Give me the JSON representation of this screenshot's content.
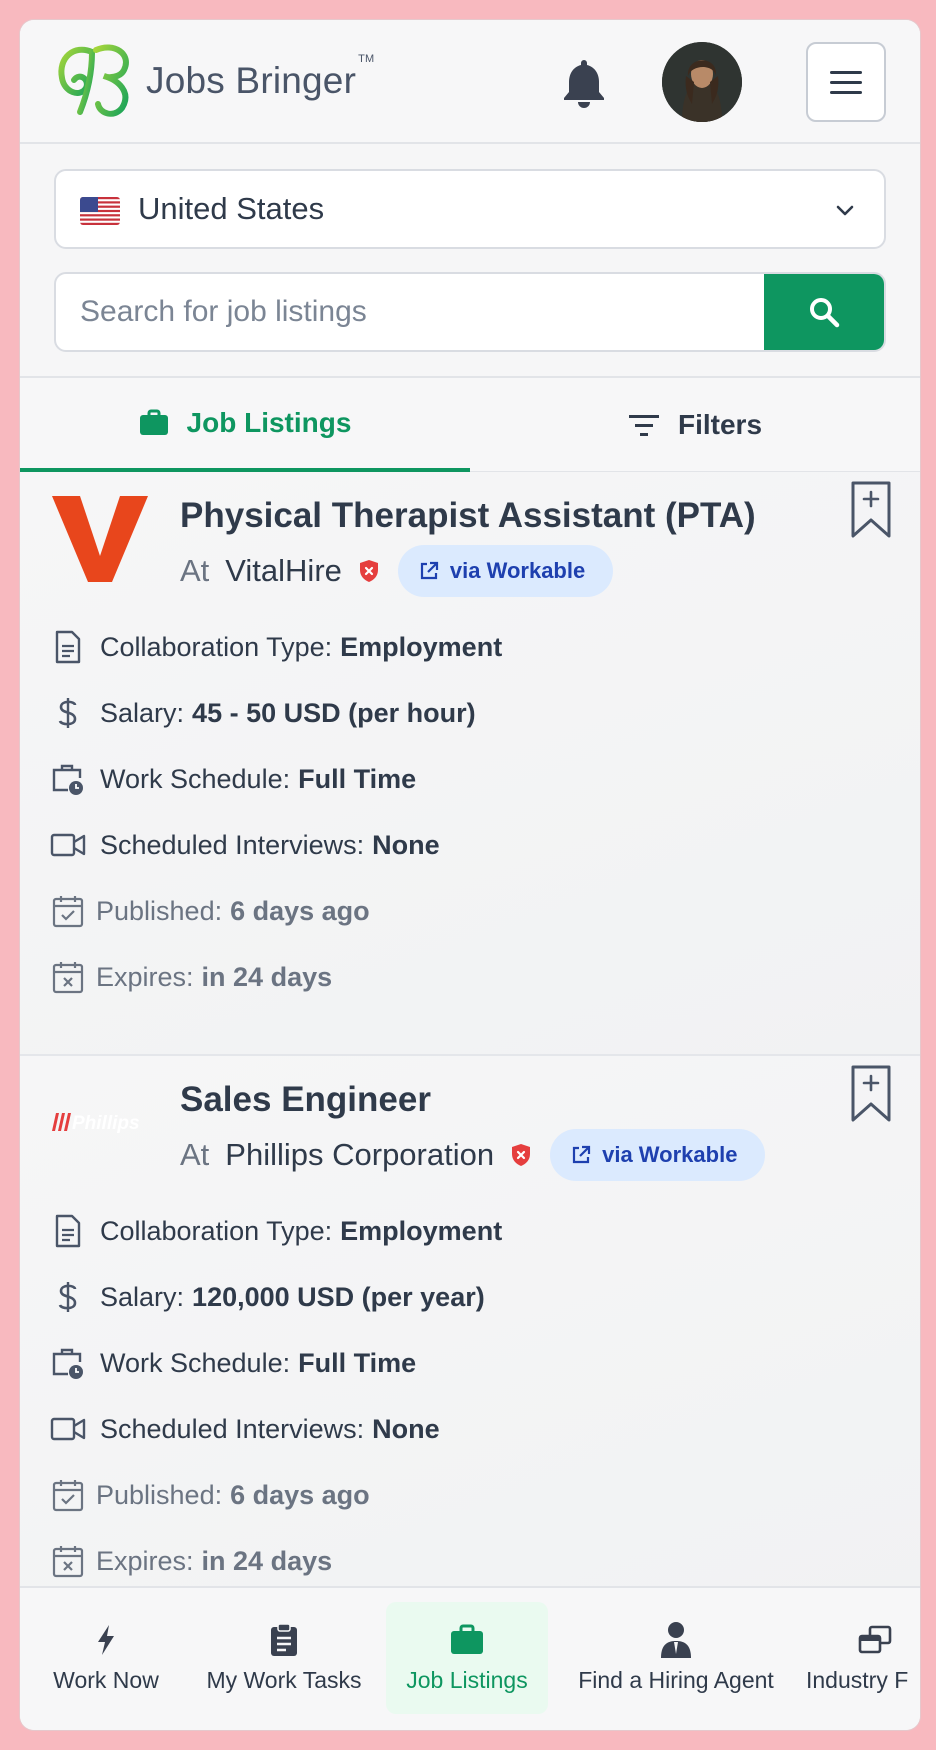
{
  "header": {
    "brand": "Jobs Bringer",
    "trademark": "TM",
    "icons": {
      "logo": "butterfly-logo",
      "notifications": "bell-icon",
      "menu": "hamburger-icon"
    }
  },
  "country": {
    "selected": "United States",
    "flag": "us-flag-icon"
  },
  "search": {
    "placeholder": "Search for job listings"
  },
  "tabs": [
    {
      "label": "Job Listings",
      "active": true
    },
    {
      "label": "Filters",
      "active": false
    }
  ],
  "jobs": [
    {
      "title": "Physical Therapist Assistant (PTA)",
      "at": "At",
      "company": "VitalHire",
      "source": "via Workable",
      "collab_label": "Collaboration Type:",
      "collab": "Employment",
      "salary_label": "Salary:",
      "salary": "45 - 50 USD (per hour)",
      "schedule_label": "Work Schedule:",
      "schedule": "Full Time",
      "interviews_label": "Scheduled Interviews:",
      "interviews": "None",
      "published_label": "Published:",
      "published": "6 days ago",
      "expires_label": "Expires:",
      "expires": "in 24 days"
    },
    {
      "title": "Sales Engineer",
      "at": "At",
      "company": "Phillips Corporation",
      "company_logo_text": "Phillips",
      "source": "via Workable",
      "collab_label": "Collaboration Type:",
      "collab": "Employment",
      "salary_label": "Salary:",
      "salary": "120,000 USD (per year)",
      "schedule_label": "Work Schedule:",
      "schedule": "Full Time",
      "interviews_label": "Scheduled Interviews:",
      "interviews": "None",
      "published_label": "Published:",
      "published": "6 days ago",
      "expires_label": "Expires:",
      "expires": "in 24 days"
    }
  ],
  "bottom_nav": [
    {
      "label": "Work Now",
      "icon": "lightning-icon"
    },
    {
      "label": "My Work Tasks",
      "icon": "clipboard-icon"
    },
    {
      "label": "Job Listings",
      "icon": "briefcase-icon",
      "active": true
    },
    {
      "label": "Find a Hiring Agent",
      "icon": "agent-icon"
    },
    {
      "label": "Industry F",
      "icon": "windows-icon"
    }
  ],
  "colors": {
    "accent": "#0e9660",
    "badge_bg": "#dbeafe",
    "badge_text": "#1e40af",
    "outer_bg": "#f8b9bf"
  }
}
